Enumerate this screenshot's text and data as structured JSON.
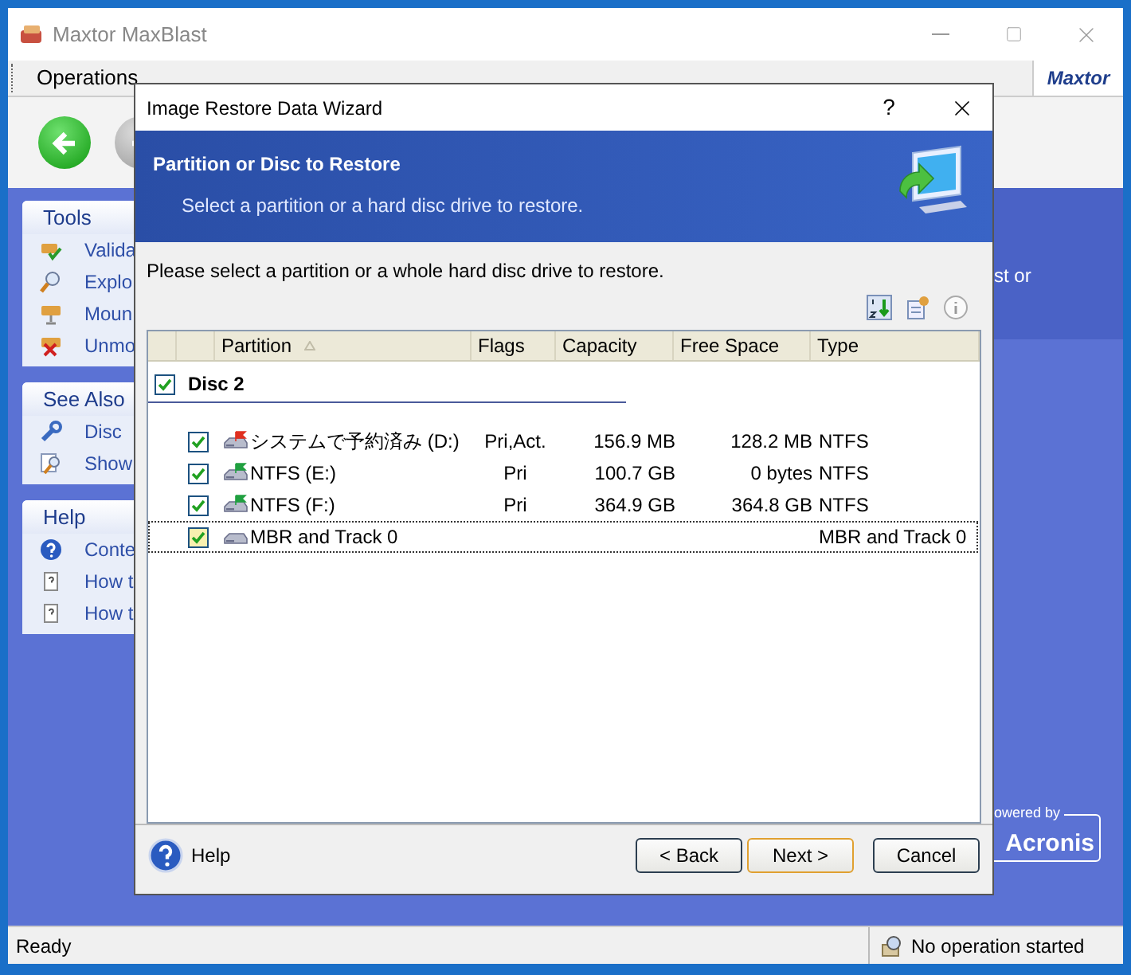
{
  "window": {
    "title": "Maxtor MaxBlast",
    "logo": "Maxtor"
  },
  "menu": [
    {
      "label": "Operations"
    }
  ],
  "toolbar": [
    {
      "kind": "back",
      "disabled": false
    },
    {
      "kind": "forward",
      "disabled": true
    }
  ],
  "sidebar": [
    {
      "title": "Tools",
      "items": [
        {
          "label": "Valida",
          "kind": "validate"
        },
        {
          "label": "Explo",
          "kind": "explore"
        },
        {
          "label": "Moun",
          "kind": "mount"
        },
        {
          "label": "Unmo",
          "kind": "unmount"
        }
      ]
    },
    {
      "title": "See Also",
      "items": [
        {
          "label": "Disc",
          "kind": "wrench"
        },
        {
          "label": "Show",
          "kind": "show"
        }
      ]
    },
    {
      "title": "Help",
      "items": [
        {
          "label": "Conte",
          "kind": "help"
        },
        {
          "label": "How t",
          "kind": "page"
        },
        {
          "label": "How t",
          "kind": "page"
        }
      ]
    }
  ],
  "right_panel": {
    "text": "st or"
  },
  "branding": {
    "powered_by": "owered by",
    "name": "Acronis"
  },
  "dialog": {
    "title": "Image Restore Data Wizard",
    "help_glyph": "?",
    "header_title": "Partition or Disc to Restore",
    "header_subtitle": "Select a partition or a hard disc drive to restore.",
    "instruction": "Please select a partition or a whole hard disc drive to restore.",
    "columns": [
      {
        "label": "Partition",
        "sorted": true
      },
      {
        "label": "Flags",
        "sorted": false
      },
      {
        "label": "Capacity",
        "sorted": false
      },
      {
        "label": "Free Space",
        "sorted": false
      },
      {
        "label": "Type",
        "sorted": false
      }
    ],
    "disc": {
      "label": "Disc 2",
      "checked": true,
      "partitions": [
        {
          "kind": "system",
          "name": "システムで予約済み (D:)",
          "flags": "Pri,Act.",
          "capacity": "156.9 MB",
          "free_space": "128.2 MB",
          "type": "NTFS",
          "checked": true,
          "focused": false
        },
        {
          "kind": "data",
          "name": "NTFS (E:)",
          "flags": "Pri",
          "capacity": "100.7 GB",
          "free_space": "0 bytes",
          "type": "NTFS",
          "checked": true,
          "focused": false
        },
        {
          "kind": "data",
          "name": "NTFS (F:)",
          "flags": "Pri",
          "capacity": "364.9 GB",
          "free_space": "364.8 GB",
          "type": "NTFS",
          "checked": true,
          "focused": false
        },
        {
          "kind": "mbr",
          "name": "MBR and Track 0",
          "type": "MBR and Track 0",
          "checked": true,
          "focused": true
        }
      ]
    },
    "help_label": "Help",
    "buttons": [
      {
        "label": "< Back",
        "default": false
      },
      {
        "label": "Next >",
        "default": true
      },
      {
        "label": "Cancel",
        "default": false
      }
    ]
  },
  "status_bar": {
    "text": "Ready",
    "operation": "No operation started"
  }
}
